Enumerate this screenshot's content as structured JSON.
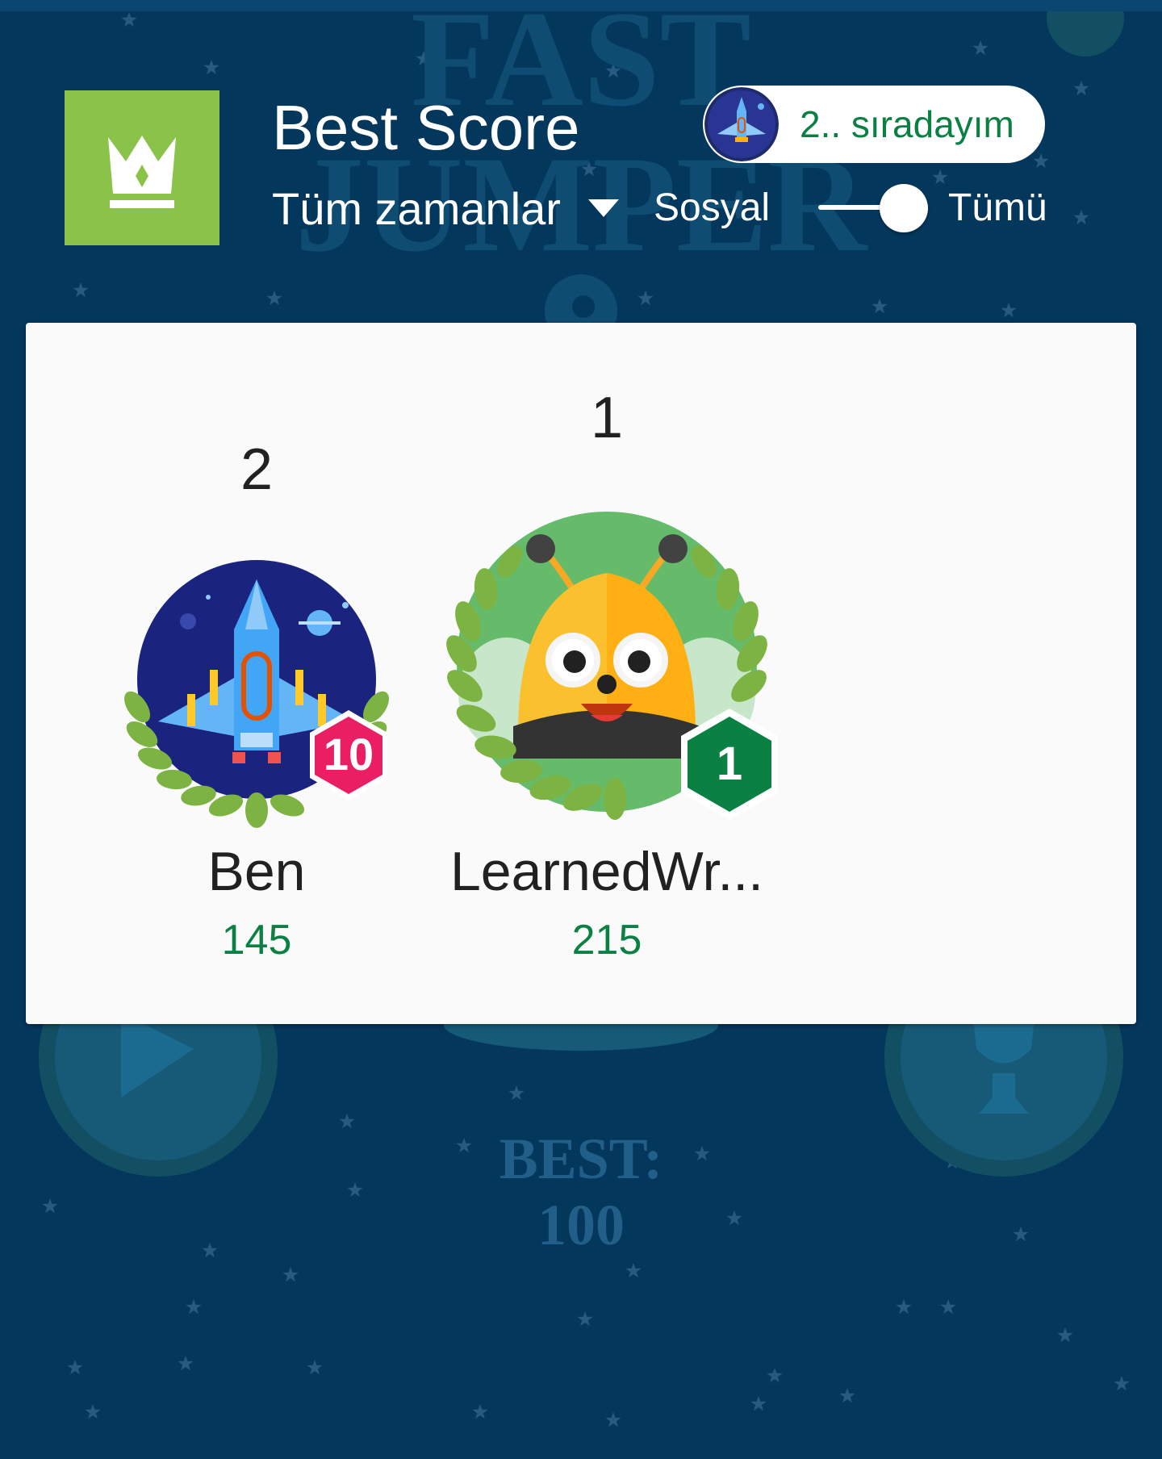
{
  "header": {
    "title": "Best Score",
    "period_label": "Tüm zamanlar",
    "rank_status": "2.. sıradayım",
    "toggle": {
      "left_label": "Sosyal",
      "right_label": "Tümü",
      "selected": "Tümü"
    }
  },
  "background": {
    "game_title_lines": [
      "FAST",
      "JUMPER"
    ],
    "best_label": "BEST:",
    "best_value": "100"
  },
  "players": [
    {
      "rank": "2",
      "name": "Ben",
      "score": "145",
      "level": "10",
      "avatar": "spaceship-avatar-icon"
    },
    {
      "rank": "1",
      "name": "LearnedWr...",
      "score": "215",
      "level": "1",
      "avatar": "bee-avatar-icon"
    }
  ],
  "colors": {
    "background": "#04375c",
    "crown_tile": "#8bc34a",
    "score_green": "#0b8043",
    "level_badge_pink": "#e91e63",
    "level_badge_green": "#0b8043"
  }
}
